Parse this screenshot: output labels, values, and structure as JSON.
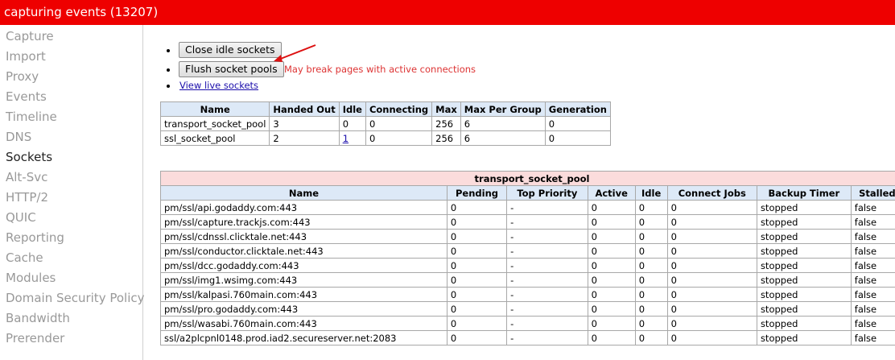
{
  "titlebar": {
    "title": "capturing events (13207)"
  },
  "sidebar": {
    "items": [
      {
        "label": "Capture"
      },
      {
        "label": "Import"
      },
      {
        "label": "Proxy"
      },
      {
        "label": "Events"
      },
      {
        "label": "Timeline"
      },
      {
        "label": "DNS"
      },
      {
        "label": "Sockets",
        "active": true
      },
      {
        "label": "Alt-Svc"
      },
      {
        "label": "HTTP/2"
      },
      {
        "label": "QUIC"
      },
      {
        "label": "Reporting"
      },
      {
        "label": "Cache"
      },
      {
        "label": "Modules"
      },
      {
        "label": "Domain Security Policy"
      },
      {
        "label": "Bandwidth"
      },
      {
        "label": "Prerender"
      }
    ]
  },
  "actions": {
    "close_idle_label": "Close idle sockets",
    "flush_label": "Flush socket pools",
    "flush_warning": "May break pages with active connections",
    "view_live_label": "View live sockets"
  },
  "summary_table": {
    "headers": [
      "Name",
      "Handed Out",
      "Idle",
      "Connecting",
      "Max",
      "Max Per Group",
      "Generation"
    ],
    "rows": [
      [
        "transport_socket_pool",
        "3",
        "0",
        "0",
        "256",
        "6",
        "0"
      ],
      [
        "ssl_socket_pool",
        "2",
        "1",
        "0",
        "256",
        "6",
        "0"
      ]
    ]
  },
  "pool_table": {
    "caption": "transport_socket_pool",
    "headers": [
      "Name",
      "Pending",
      "Top Priority",
      "Active",
      "Idle",
      "Connect Jobs",
      "Backup Timer",
      "Stalled"
    ],
    "rows": [
      [
        "pm/ssl/api.godaddy.com:443",
        "0",
        "-",
        "0",
        "0",
        "0",
        "stopped",
        "false"
      ],
      [
        "pm/ssl/capture.trackjs.com:443",
        "0",
        "-",
        "0",
        "0",
        "0",
        "stopped",
        "false"
      ],
      [
        "pm/ssl/cdnssl.clicktale.net:443",
        "0",
        "-",
        "0",
        "0",
        "0",
        "stopped",
        "false"
      ],
      [
        "pm/ssl/conductor.clicktale.net:443",
        "0",
        "-",
        "0",
        "0",
        "0",
        "stopped",
        "false"
      ],
      [
        "pm/ssl/dcc.godaddy.com:443",
        "0",
        "-",
        "0",
        "0",
        "0",
        "stopped",
        "false"
      ],
      [
        "pm/ssl/img1.wsimg.com:443",
        "0",
        "-",
        "0",
        "0",
        "0",
        "stopped",
        "false"
      ],
      [
        "pm/ssl/kalpasi.760main.com:443",
        "0",
        "-",
        "0",
        "0",
        "0",
        "stopped",
        "false"
      ],
      [
        "pm/ssl/pro.godaddy.com:443",
        "0",
        "-",
        "0",
        "0",
        "0",
        "stopped",
        "false"
      ],
      [
        "pm/ssl/wasabi.760main.com:443",
        "0",
        "-",
        "0",
        "0",
        "0",
        "stopped",
        "false"
      ],
      [
        "ssl/a2plcpnl0148.prod.iad2.secureserver.net:2083",
        "0",
        "-",
        "0",
        "0",
        "0",
        "stopped",
        "false"
      ]
    ]
  },
  "colors": {
    "titlebar_bg": "#ee0000",
    "header_bg": "#dde9f7",
    "caption_bg": "#fbdcdc",
    "warning_text": "#dd3333",
    "annotation_arrow": "#dd1111"
  }
}
